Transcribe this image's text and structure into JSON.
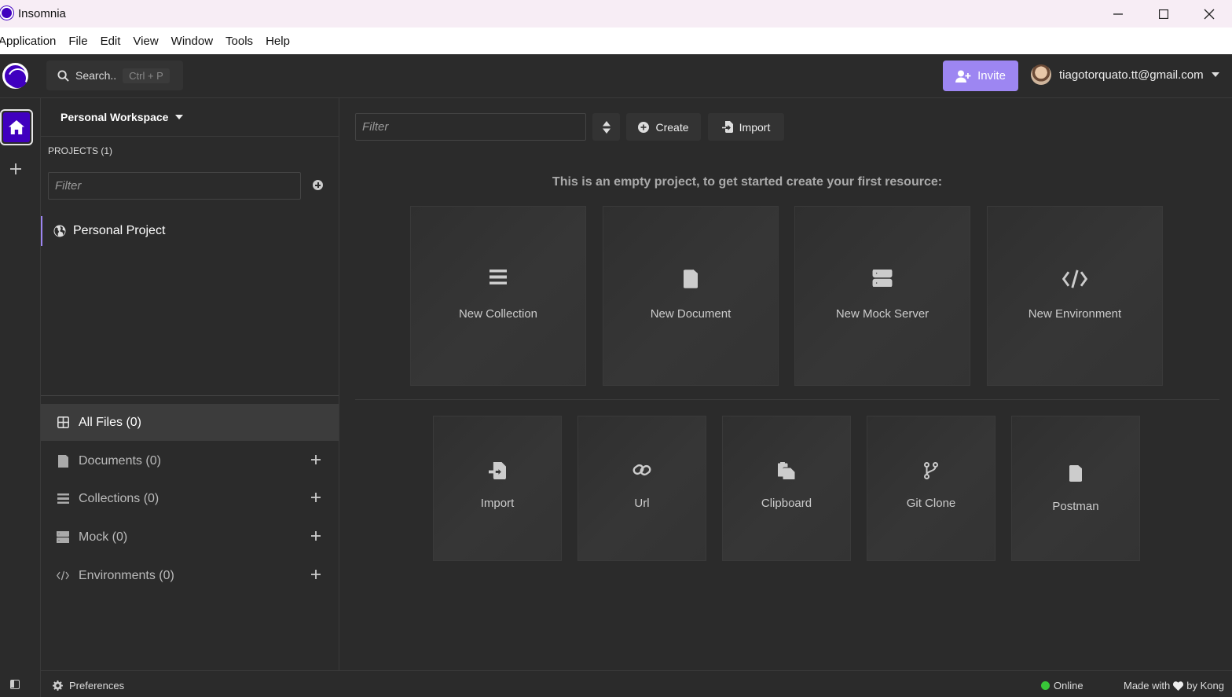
{
  "window": {
    "title": "Insomnia"
  },
  "menu": [
    "Application",
    "File",
    "Edit",
    "View",
    "Window",
    "Tools",
    "Help"
  ],
  "header": {
    "search_label": "Search..",
    "search_shortcut": "Ctrl + P",
    "invite_label": "Invite",
    "user_email": "tiagotorquato.tt@gmail.com"
  },
  "sidebar": {
    "workspace_name": "Personal Workspace",
    "projects_label": "PROJECTS (1)",
    "project_filter_placeholder": "Filter",
    "projects": [
      {
        "name": "Personal Project",
        "icon": "globe-icon"
      }
    ],
    "file_groups": [
      {
        "label": "All Files (0)",
        "icon": "grid-icon"
      },
      {
        "label": "Documents (0)",
        "icon": "document-icon"
      },
      {
        "label": "Collections (0)",
        "icon": "list-icon"
      },
      {
        "label": "Mock (0)",
        "icon": "server-icon"
      },
      {
        "label": "Environments (0)",
        "icon": "code-icon"
      }
    ]
  },
  "main": {
    "filter_placeholder": "Filter",
    "create_label": "Create",
    "import_label": "Import",
    "empty_message": "This is an empty project, to get started create your first resource:",
    "create_cards": [
      {
        "label": "New Collection",
        "icon": "list-icon"
      },
      {
        "label": "New Document",
        "icon": "document-icon"
      },
      {
        "label": "New Mock Server",
        "icon": "server-icon"
      },
      {
        "label": "New Environment",
        "icon": "code-icon"
      }
    ],
    "import_cards": [
      {
        "label": "Import",
        "icon": "file-import-icon"
      },
      {
        "label": "Url",
        "icon": "link-icon"
      },
      {
        "label": "Clipboard",
        "icon": "clipboard-icon"
      },
      {
        "label": "Git Clone",
        "icon": "git-branch-icon"
      },
      {
        "label": "Postman",
        "icon": "document-icon"
      }
    ]
  },
  "statusbar": {
    "preferences_label": "Preferences",
    "status_label": "Online",
    "status_color": "#38c538",
    "made_with_prefix": "Made with",
    "made_with_suffix": "by Kong"
  },
  "colors": {
    "brand": "#4000bf",
    "accent": "#9d86f2",
    "background": "#2b2b2b"
  }
}
